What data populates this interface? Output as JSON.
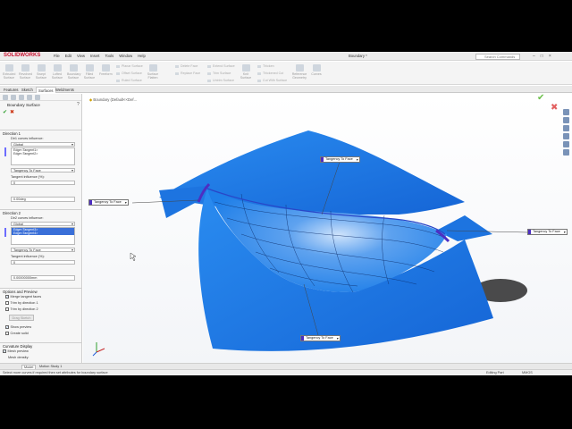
{
  "app": {
    "logo": "SOLIDWORKS",
    "document_title": "Boundary *",
    "search_placeholder": "Search Commands"
  },
  "menu": [
    "File",
    "Edit",
    "View",
    "Insert",
    "Tools",
    "Window",
    "Help"
  ],
  "ribbon": {
    "big_buttons": [
      "Extruded Surface",
      "Revolved Surface",
      "Swept Surface",
      "Lofted Surface",
      "Boundary Surface",
      "Filled Surface",
      "Freeform"
    ],
    "small_items": [
      "Planar Surface",
      "Offset Surface",
      "Ruled Surface",
      "Delete Face",
      "Replace Face",
      "Extend Surface",
      "Trim Surface",
      "Untrim Surface",
      "Thicken",
      "Thickened Cut",
      "Cut With Surface"
    ],
    "other_buttons": [
      "Surface Flatten",
      "Knit Surface",
      "Reference Geometry",
      "Curves"
    ]
  },
  "command_tabs": [
    "Features",
    "Sketch",
    "Surfaces",
    "Weldments"
  ],
  "feature_manager_path": "Boundary (Default<<Def...",
  "property_manager": {
    "title": "Boundary Surface",
    "direction1": {
      "header": "Direction 1",
      "influence_label": "Dir1 curves influence:",
      "influence_value": "Global",
      "curves": [
        "Edge<Tangent1>",
        "Edge<Tangent2>"
      ],
      "condition": "Tangency To Face",
      "tangent_influence_label": "Tangent influence (%):",
      "tangent_value": "0",
      "angle_value": "0.00deg"
    },
    "direction2": {
      "header": "Direction 2",
      "influence_label": "Dir2 curves influence:",
      "influence_value": "Global",
      "curves": [
        "Edge<Tangent3>",
        "Edge<Tangent4>"
      ],
      "condition1": "Tangency To Face",
      "condition2": "Tangency To Face",
      "tangent_influence_label": "Tangent influence (%):",
      "tangent_value": "0",
      "length_value": "0.00000000mm"
    },
    "options": {
      "header": "Options and Preview",
      "merge": "Merge tangent faces",
      "trim1": "Trim by direction 1",
      "trim2": "Trim by direction 2",
      "drag_button": "Drag Sketch",
      "show_preview": "Show preview",
      "create_solid": "Create solid"
    },
    "curvature": {
      "header": "Curvature Display",
      "mesh_preview": "Mesh preview",
      "mesh_density": "Mesh density:"
    }
  },
  "callouts": [
    "Tangency To Face",
    "Tangency To Face",
    "Tangency To Face",
    "Tangency To Face"
  ],
  "bottom_tabs": [
    "Model",
    "Motion Study 1"
  ],
  "status": {
    "message": "Select more curves if required then set attributes for boundary surface",
    "mode": "Editing Part",
    "units": "MMGS"
  },
  "colors": {
    "surface_blue": "#1f7fe8",
    "surface_dark": "#1160c8",
    "boundary_highlight": "#5a3ae0",
    "accent": "#c8102e"
  }
}
